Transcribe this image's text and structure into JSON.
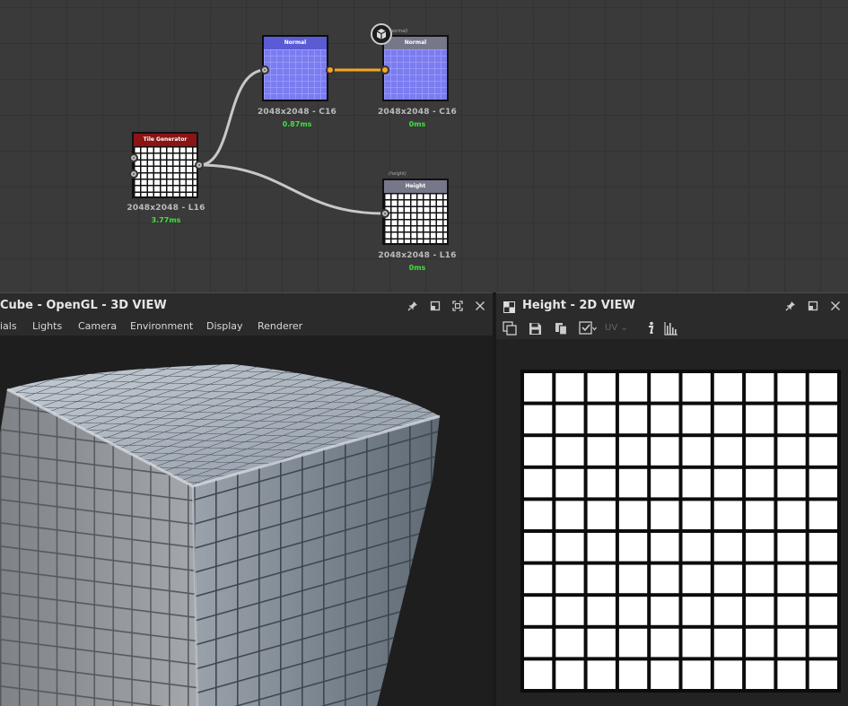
{
  "graph": {
    "nodes": [
      {
        "id": "tile-generator",
        "title": "Tile Generator",
        "info": "2048x2048 - L16",
        "time": "3.77ms"
      },
      {
        "id": "normal-1",
        "title": "Normal",
        "info": "2048x2048 - C16",
        "time": "0.87ms"
      },
      {
        "id": "normal-output",
        "title": "Normal",
        "tag": "(normal)",
        "info": "2048x2048 - C16",
        "time": "0ms"
      },
      {
        "id": "height-output",
        "title": "Height",
        "tag": "(height)",
        "info": "2048x2048 - L16",
        "time": "0ms"
      }
    ],
    "colors": {
      "tile_header": "#8b1414",
      "normal_header": "#5b5bd6",
      "output_header": "#77778a",
      "wire": "#c8c8c8",
      "active_wire": "#f5a623",
      "time_text": "#3fe03f"
    },
    "output_icon": "cube-icon"
  },
  "view3d": {
    "title": "Cube - OpenGL - 3D VIEW",
    "menu": [
      "ials",
      "Lights",
      "Camera",
      "Environment",
      "Display",
      "Renderer"
    ],
    "icons": [
      "pin-icon",
      "restore-icon",
      "maximize-icon",
      "close-icon"
    ]
  },
  "view2d": {
    "title": "Height - 2D VIEW",
    "uv_label": "UV",
    "icons": [
      "checker-icon",
      "pin-icon",
      "restore-icon",
      "close-icon"
    ],
    "toolbar": [
      "export-icon",
      "save-icon",
      "copy-icon",
      "display-options-icon",
      "uv-dropdown",
      "info-icon",
      "histogram-icon"
    ],
    "texture_grid": {
      "rows": 10,
      "cols": 10
    }
  }
}
